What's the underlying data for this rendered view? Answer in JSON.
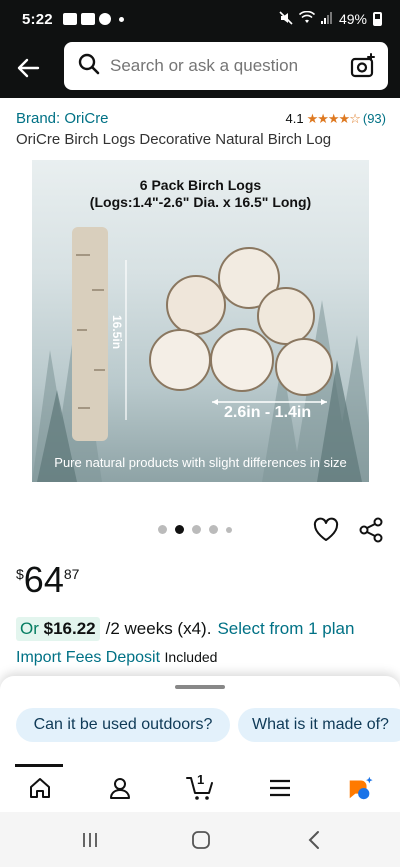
{
  "status_bar": {
    "time": "5:22",
    "battery": "49%"
  },
  "search": {
    "placeholder": "Search or ask a question"
  },
  "product": {
    "brand": "Brand: OriCre",
    "rating_value": "4.1",
    "stars": "★★★★☆",
    "rating_count": "(93)",
    "title": "OriCre Birch Logs Decorative Natural Birch Log",
    "image": {
      "caption_line1": "6 Pack Birch Logs",
      "caption_line2": "(Logs:1.4\"-2.6\" Dia. x 16.5\" Long)",
      "length_label": "16.5in",
      "diameter_label": "2.6in - 1.4in",
      "bottom_caption": "Pure natural products with slight differences in size"
    },
    "carousel": {
      "count": 5,
      "active_index": 1
    },
    "price": {
      "symbol": "$",
      "whole": "64",
      "fraction": "87"
    },
    "plan": {
      "prefix": "Or",
      "amount": "$16.22",
      "term": "/2 weeks (x4).",
      "link": "Select from 1 plan"
    },
    "import": {
      "label": "Import Fees Deposit",
      "value": "Included"
    }
  },
  "suggestions": [
    "Can it be used outdoors?",
    "What is it made of?"
  ],
  "bottom_nav": {
    "cart_count": "1",
    "items": [
      "home-icon",
      "account-icon",
      "cart-icon",
      "menu-icon",
      "rufus-icon"
    ]
  },
  "colors": {
    "link": "#007185",
    "star": "#de7921",
    "header": "#0f1111",
    "chip": "#e3f1fb",
    "ai_orange": "#ff7a00",
    "ai_blue": "#1a73e8"
  }
}
